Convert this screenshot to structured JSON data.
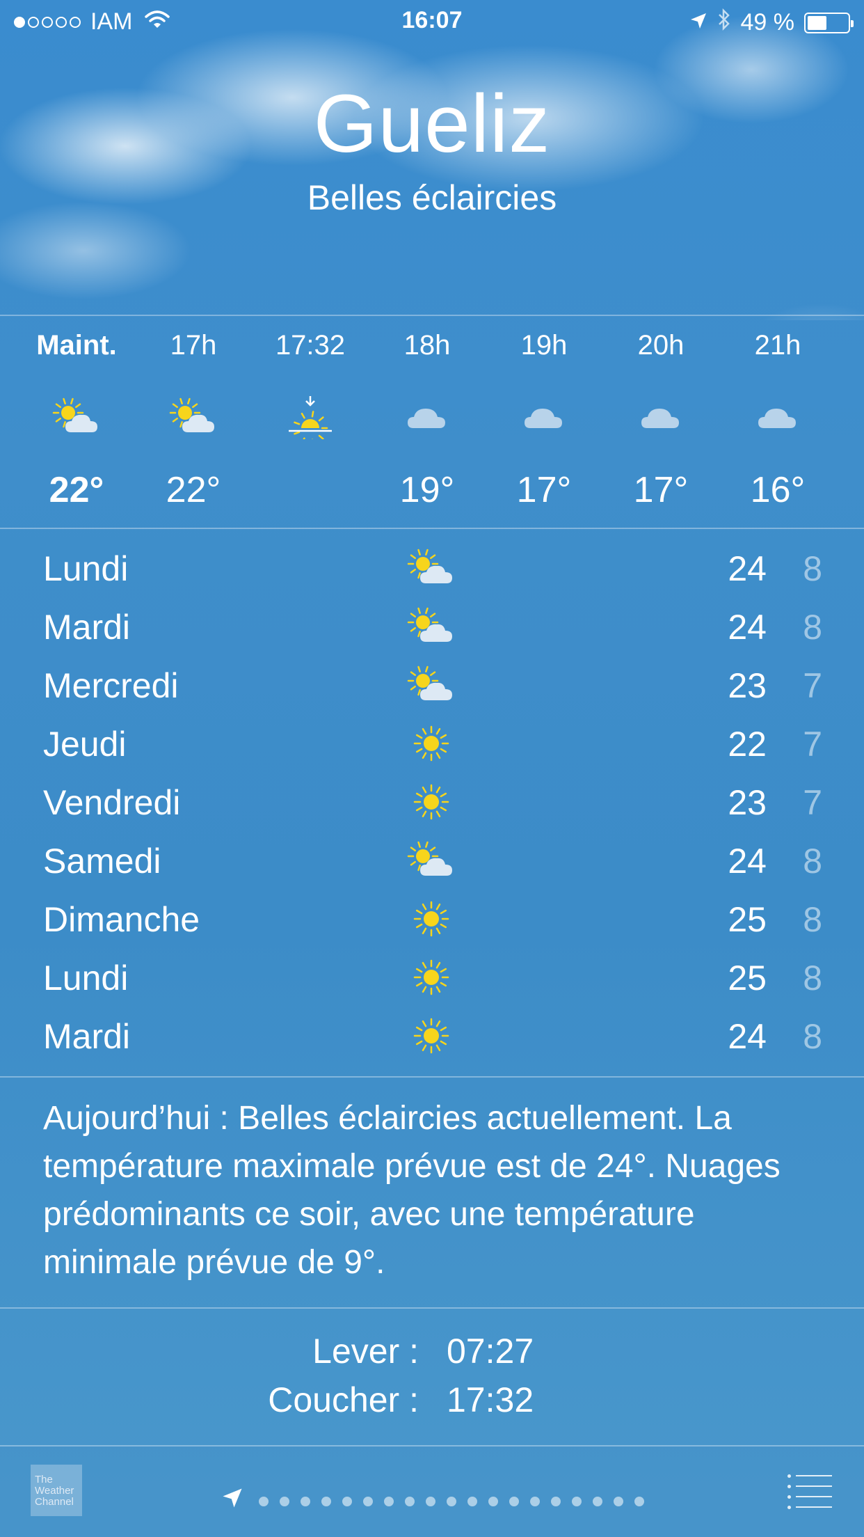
{
  "status_bar": {
    "carrier": "IAM",
    "signal_dots_filled": 1,
    "signal_dots_total": 5,
    "time": "16:07",
    "battery_percent": "49 %",
    "battery_level": 0.49
  },
  "header": {
    "city": "Gueliz",
    "condition": "Belles éclaircies"
  },
  "hourly": [
    {
      "label": "Maint.",
      "icon": "partly-sunny-icon",
      "temp": "22°",
      "now": true
    },
    {
      "label": "17h",
      "icon": "partly-sunny-icon",
      "temp": "22°",
      "now": false
    },
    {
      "label": "17:32",
      "icon": "sunset-icon",
      "temp": "",
      "now": false
    },
    {
      "label": "18h",
      "icon": "cloud-icon",
      "temp": "19°",
      "now": false
    },
    {
      "label": "19h",
      "icon": "cloud-icon",
      "temp": "17°",
      "now": false
    },
    {
      "label": "20h",
      "icon": "cloud-icon",
      "temp": "17°",
      "now": false
    },
    {
      "label": "21h",
      "icon": "cloud-icon",
      "temp": "16°",
      "now": false
    }
  ],
  "daily": [
    {
      "day": "Lundi",
      "icon": "partly-sunny-icon",
      "high": "24",
      "low": "8"
    },
    {
      "day": "Mardi",
      "icon": "partly-sunny-icon",
      "high": "24",
      "low": "8"
    },
    {
      "day": "Mercredi",
      "icon": "partly-sunny-icon",
      "high": "23",
      "low": "7"
    },
    {
      "day": "Jeudi",
      "icon": "sun-icon",
      "high": "22",
      "low": "7"
    },
    {
      "day": "Vendredi",
      "icon": "sun-icon",
      "high": "23",
      "low": "7"
    },
    {
      "day": "Samedi",
      "icon": "partly-sunny-icon",
      "high": "24",
      "low": "8"
    },
    {
      "day": "Dimanche",
      "icon": "sun-icon",
      "high": "25",
      "low": "8"
    },
    {
      "day": "Lundi",
      "icon": "sun-icon",
      "high": "25",
      "low": "8"
    },
    {
      "day": "Mardi",
      "icon": "sun-icon",
      "high": "24",
      "low": "8"
    }
  ],
  "summary": "Aujourd’hui : Belles éclaircies actuellement. La température maximale prévue est de 24°. Nuages prédominants ce soir, avec une température minimale prévue de 9°.",
  "sun": {
    "sunrise_label": "Lever :",
    "sunrise_time": "07:27",
    "sunset_label": "Coucher :",
    "sunset_time": "17:32"
  },
  "bottom_bar": {
    "logo_text": "The Weather Channel",
    "page_dots": 19,
    "list_icon": "list-icon"
  },
  "colors": {
    "sun_yellow": "#f7d51c",
    "cloud_light": "#dde9f4",
    "cloud_blue": "#b8d3ea",
    "background_blue": "#3e8dc9"
  }
}
